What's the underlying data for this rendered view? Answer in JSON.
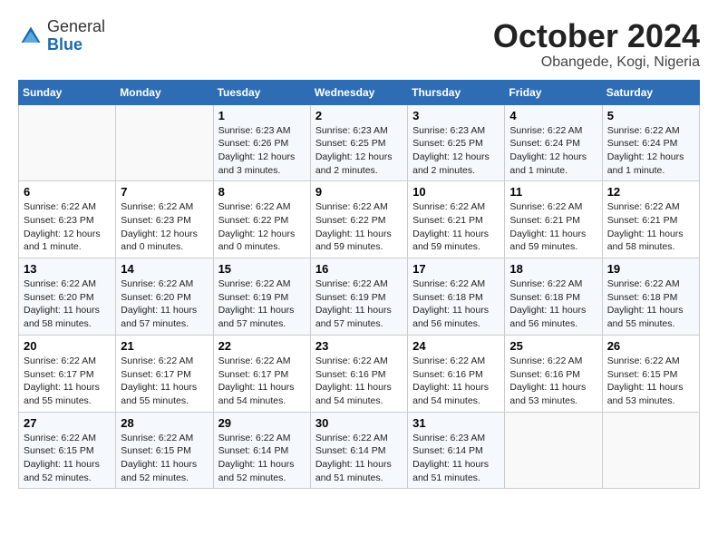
{
  "header": {
    "logo_line1": "General",
    "logo_line2": "Blue",
    "month_title": "October 2024",
    "location": "Obangede, Kogi, Nigeria"
  },
  "calendar": {
    "days_of_week": [
      "Sunday",
      "Monday",
      "Tuesday",
      "Wednesday",
      "Thursday",
      "Friday",
      "Saturday"
    ],
    "weeks": [
      [
        {
          "day": "",
          "info": ""
        },
        {
          "day": "",
          "info": ""
        },
        {
          "day": "1",
          "info": "Sunrise: 6:23 AM\nSunset: 6:26 PM\nDaylight: 12 hours and 3 minutes."
        },
        {
          "day": "2",
          "info": "Sunrise: 6:23 AM\nSunset: 6:25 PM\nDaylight: 12 hours and 2 minutes."
        },
        {
          "day": "3",
          "info": "Sunrise: 6:23 AM\nSunset: 6:25 PM\nDaylight: 12 hours and 2 minutes."
        },
        {
          "day": "4",
          "info": "Sunrise: 6:22 AM\nSunset: 6:24 PM\nDaylight: 12 hours and 1 minute."
        },
        {
          "day": "5",
          "info": "Sunrise: 6:22 AM\nSunset: 6:24 PM\nDaylight: 12 hours and 1 minute."
        }
      ],
      [
        {
          "day": "6",
          "info": "Sunrise: 6:22 AM\nSunset: 6:23 PM\nDaylight: 12 hours and 1 minute."
        },
        {
          "day": "7",
          "info": "Sunrise: 6:22 AM\nSunset: 6:23 PM\nDaylight: 12 hours and 0 minutes."
        },
        {
          "day": "8",
          "info": "Sunrise: 6:22 AM\nSunset: 6:22 PM\nDaylight: 12 hours and 0 minutes."
        },
        {
          "day": "9",
          "info": "Sunrise: 6:22 AM\nSunset: 6:22 PM\nDaylight: 11 hours and 59 minutes."
        },
        {
          "day": "10",
          "info": "Sunrise: 6:22 AM\nSunset: 6:21 PM\nDaylight: 11 hours and 59 minutes."
        },
        {
          "day": "11",
          "info": "Sunrise: 6:22 AM\nSunset: 6:21 PM\nDaylight: 11 hours and 59 minutes."
        },
        {
          "day": "12",
          "info": "Sunrise: 6:22 AM\nSunset: 6:21 PM\nDaylight: 11 hours and 58 minutes."
        }
      ],
      [
        {
          "day": "13",
          "info": "Sunrise: 6:22 AM\nSunset: 6:20 PM\nDaylight: 11 hours and 58 minutes."
        },
        {
          "day": "14",
          "info": "Sunrise: 6:22 AM\nSunset: 6:20 PM\nDaylight: 11 hours and 57 minutes."
        },
        {
          "day": "15",
          "info": "Sunrise: 6:22 AM\nSunset: 6:19 PM\nDaylight: 11 hours and 57 minutes."
        },
        {
          "day": "16",
          "info": "Sunrise: 6:22 AM\nSunset: 6:19 PM\nDaylight: 11 hours and 57 minutes."
        },
        {
          "day": "17",
          "info": "Sunrise: 6:22 AM\nSunset: 6:18 PM\nDaylight: 11 hours and 56 minutes."
        },
        {
          "day": "18",
          "info": "Sunrise: 6:22 AM\nSunset: 6:18 PM\nDaylight: 11 hours and 56 minutes."
        },
        {
          "day": "19",
          "info": "Sunrise: 6:22 AM\nSunset: 6:18 PM\nDaylight: 11 hours and 55 minutes."
        }
      ],
      [
        {
          "day": "20",
          "info": "Sunrise: 6:22 AM\nSunset: 6:17 PM\nDaylight: 11 hours and 55 minutes."
        },
        {
          "day": "21",
          "info": "Sunrise: 6:22 AM\nSunset: 6:17 PM\nDaylight: 11 hours and 55 minutes."
        },
        {
          "day": "22",
          "info": "Sunrise: 6:22 AM\nSunset: 6:17 PM\nDaylight: 11 hours and 54 minutes."
        },
        {
          "day": "23",
          "info": "Sunrise: 6:22 AM\nSunset: 6:16 PM\nDaylight: 11 hours and 54 minutes."
        },
        {
          "day": "24",
          "info": "Sunrise: 6:22 AM\nSunset: 6:16 PM\nDaylight: 11 hours and 54 minutes."
        },
        {
          "day": "25",
          "info": "Sunrise: 6:22 AM\nSunset: 6:16 PM\nDaylight: 11 hours and 53 minutes."
        },
        {
          "day": "26",
          "info": "Sunrise: 6:22 AM\nSunset: 6:15 PM\nDaylight: 11 hours and 53 minutes."
        }
      ],
      [
        {
          "day": "27",
          "info": "Sunrise: 6:22 AM\nSunset: 6:15 PM\nDaylight: 11 hours and 52 minutes."
        },
        {
          "day": "28",
          "info": "Sunrise: 6:22 AM\nSunset: 6:15 PM\nDaylight: 11 hours and 52 minutes."
        },
        {
          "day": "29",
          "info": "Sunrise: 6:22 AM\nSunset: 6:14 PM\nDaylight: 11 hours and 52 minutes."
        },
        {
          "day": "30",
          "info": "Sunrise: 6:22 AM\nSunset: 6:14 PM\nDaylight: 11 hours and 51 minutes."
        },
        {
          "day": "31",
          "info": "Sunrise: 6:23 AM\nSunset: 6:14 PM\nDaylight: 11 hours and 51 minutes."
        },
        {
          "day": "",
          "info": ""
        },
        {
          "day": "",
          "info": ""
        }
      ]
    ]
  }
}
